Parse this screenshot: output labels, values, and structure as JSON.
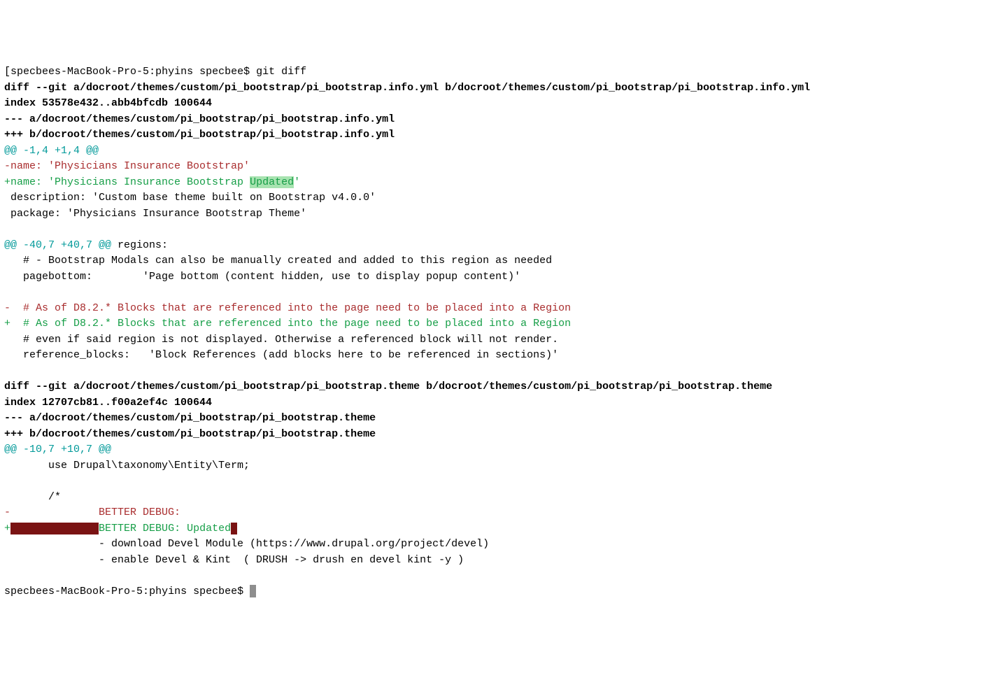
{
  "prompt1": {
    "prefix": "[",
    "host": "specbees-MacBook-Pro-5",
    "sep": ":",
    "cwd": "phyins",
    "user": "specbee",
    "dollar": "$",
    "cmd": "git diff"
  },
  "diff1": {
    "header": "diff --git a/docroot/themes/custom/pi_bootstrap/pi_bootstrap.info.yml b/docroot/themes/custom/pi_bootstrap/pi_bootstrap.info.yml",
    "index": "index 53578e432..abb4bfcdb 100644",
    "minusfile": "--- a/docroot/themes/custom/pi_bootstrap/pi_bootstrap.info.yml",
    "plusfile": "+++ b/docroot/themes/custom/pi_bootstrap/pi_bootstrap.info.yml",
    "hunk1_header": "@@ -1,4 +1,4 @@",
    "h1_del1": "-name: 'Physicians Insurance Bootstrap'",
    "h1_add1_pre": "+name: 'Physicians Insurance Bootstrap ",
    "h1_add1_hl": "Updated",
    "h1_add1_post": "'",
    "h1_ctx1": " description: 'Custom base theme built on Bootstrap v4.0.0'",
    "h1_ctx2": " package: 'Physicians Insurance Bootstrap Theme'",
    "hunk2_header": "@@ -40,7 +40,7 @@",
    "hunk2_trailer": " regions:",
    "h2_ctx1": "   # - Bootstrap Modals can also be manually created and added to this region as needed",
    "h2_ctx2": "   pagebottom:        'Page bottom (content hidden, use to display popup content)'",
    "h2_del1": "-  # As of D8.2.* Blocks that are referenced into the page need to be placed into a Region",
    "h2_add1": "+  # As of D8.2.* Blocks that are referenced into the page need to be placed into a Region",
    "h2_ctx3": "   # even if said region is not displayed. Otherwise a referenced block will not render.",
    "h2_ctx4": "   reference_blocks:   'Block References (add blocks here to be referenced in sections)'"
  },
  "diff2": {
    "header": "diff --git a/docroot/themes/custom/pi_bootstrap/pi_bootstrap.theme b/docroot/themes/custom/pi_bootstrap/pi_bootstrap.theme",
    "index": "index 12707cb81..f00a2ef4c 100644",
    "minusfile": "--- a/docroot/themes/custom/pi_bootstrap/pi_bootstrap.theme",
    "plusfile": "+++ b/docroot/themes/custom/pi_bootstrap/pi_bootstrap.theme",
    "hunk1_header": "@@ -10,7 +10,7 @@",
    "h1_ctx1": "       use Drupal\\taxonomy\\Entity\\Term;",
    "h1_ctx2": "       /*",
    "h1_del1_prefix": "-",
    "h1_del1_text": "              BETTER DEBUG:",
    "h1_add1_prefix": "+",
    "h1_add1_hlspace": "              ",
    "h1_add1_text": "BETTER DEBUG: Updated",
    "h1_ctx3": "               - download Devel Module (https://www.drupal.org/project/devel)",
    "h1_ctx4": "               - enable Devel & Kint  ( DRUSH -> drush en devel kint -y )"
  },
  "prompt2": {
    "host": "specbees-MacBook-Pro-5",
    "sep": ":",
    "cwd": "phyins",
    "user": "specbee",
    "dollar": "$"
  }
}
